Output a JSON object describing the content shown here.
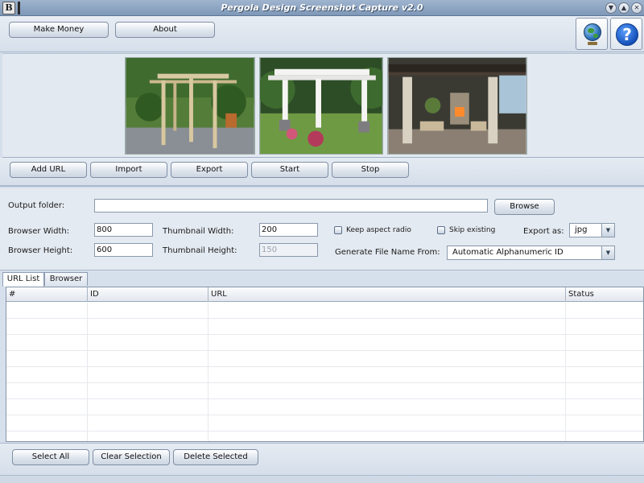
{
  "window": {
    "title": "Pergola Design Screenshot Capture v2.0",
    "controls": [
      "minimize-icon",
      "maximize-icon",
      "close-icon"
    ]
  },
  "top_toolbar": {
    "make_money": "Make Money",
    "about": "About",
    "globe_icon": "globe-icon",
    "help_icon": "?"
  },
  "images": [
    "pergola-wooden-garden",
    "pergola-white-patio",
    "pergola-stone-outdoor-room"
  ],
  "actions": {
    "add_url": "Add URL",
    "import": "Import",
    "export": "Export",
    "start": "Start",
    "stop": "Stop"
  },
  "settings": {
    "output_folder_label": "Output folder:",
    "output_folder_value": "",
    "browse": "Browse",
    "browser_width_label": "Browser Width:",
    "browser_width_value": "800",
    "browser_height_label": "Browser Height:",
    "browser_height_value": "600",
    "thumb_width_label": "Thumbnail Width:",
    "thumb_width_value": "200",
    "thumb_height_label": "Thumbnail Height:",
    "thumb_height_value": "150",
    "keep_aspect_label": "Keep aspect radio",
    "keep_aspect_checked": false,
    "skip_existing_label": "Skip existing",
    "skip_existing_checked": false,
    "export_as_label": "Export as:",
    "export_as_value": "jpg",
    "file_name_label": "Generate File Name From:",
    "file_name_value": "Automatic Alphanumeric ID"
  },
  "tabs": [
    {
      "label": "URL List",
      "active": true
    },
    {
      "label": "Browser",
      "active": false
    }
  ],
  "table": {
    "columns": [
      "#",
      "ID",
      "URL",
      "Status"
    ],
    "rows": []
  },
  "bottom_actions": {
    "select_all": "Select All",
    "clear_selection": "Clear Selection",
    "delete_selected": "Delete Selected"
  },
  "colors": {
    "title_gradient_top": "#9fb4ce",
    "window_bg": "#d6e0ec",
    "accent_blue": "#1550b8"
  }
}
